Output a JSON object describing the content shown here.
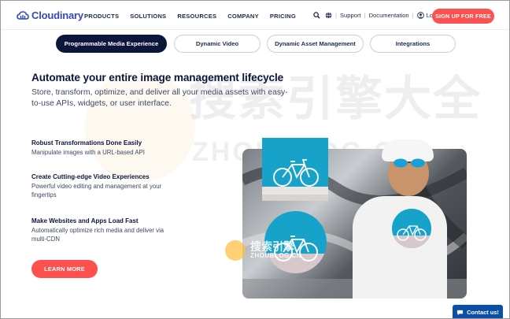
{
  "brand": {
    "name": "Cloudinary",
    "color": "#3448c5"
  },
  "nav": {
    "items": [
      "PRODUCTS",
      "SOLUTIONS",
      "RESOURCES",
      "COMPANY",
      "PRICING"
    ]
  },
  "utility": {
    "support": "Support",
    "documentation": "Documentation",
    "login": "Login",
    "signup": "SIGN UP FOR FREE"
  },
  "tabs": [
    {
      "label": "Programmable Media Experience",
      "active": true
    },
    {
      "label": "Dynamic Video",
      "active": false
    },
    {
      "label": "Dynamic Asset Management",
      "active": false
    },
    {
      "label": "Integrations",
      "active": false
    }
  ],
  "hero": {
    "headline": "Automate your entire image management lifecycle",
    "subtext": "Store, transform, optimize, and deliver all your media assets with easy-to-use APIs, widgets, or user interface."
  },
  "features": [
    {
      "title": "Robust Transformations Done Easily",
      "desc": "Manipulate images with a URL-based API"
    },
    {
      "title": "Create Cutting-edge Video Experiences",
      "desc": "Powerful video editing and management at your fingertips"
    },
    {
      "title": "Make Websites and Apps Load Fast",
      "desc": "Automatically optimize rich media and deliver via multi-CDN"
    }
  ],
  "cta": {
    "learn_more": "LEARN MORE"
  },
  "contact": {
    "label": "Contact us!"
  },
  "watermark": {
    "cn": "搜索引擎大全",
    "en": "ZHOUBLOG.CN",
    "badge_cn": "搜索引擎",
    "badge_en": "ZHOUBLOG.CN"
  },
  "colors": {
    "accent": "#ff5050",
    "navy": "#0c163b",
    "teal": "#17a2c9",
    "contact": "#0c4fa8"
  }
}
